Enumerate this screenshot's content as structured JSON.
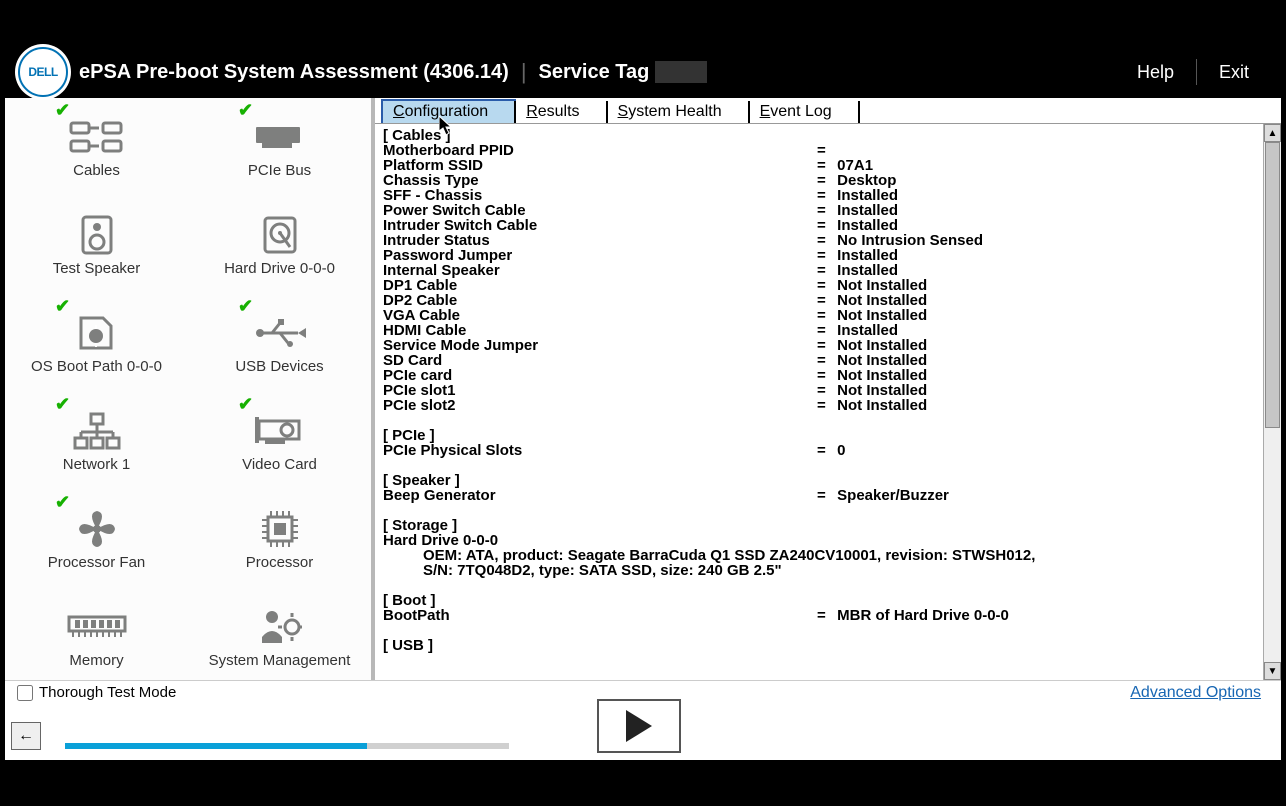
{
  "header": {
    "logo_text": "DELL",
    "title": "ePSA Pre-boot System Assessment (4306.14)",
    "service_tag_label": "Service Tag",
    "help": "Help",
    "exit": "Exit"
  },
  "sidebar": {
    "devices": [
      {
        "label": "Cables",
        "check": true,
        "name": "cables"
      },
      {
        "label": "PCIe Bus",
        "check": true,
        "name": "pcie-bus"
      },
      {
        "label": "Test Speaker",
        "check": false,
        "name": "test-speaker"
      },
      {
        "label": "Hard Drive 0-0-0",
        "check": false,
        "name": "hard-drive"
      },
      {
        "label": "OS Boot Path 0-0-0",
        "check": true,
        "name": "os-boot-path"
      },
      {
        "label": "USB Devices",
        "check": true,
        "name": "usb-devices"
      },
      {
        "label": "Network 1",
        "check": true,
        "name": "network"
      },
      {
        "label": "Video Card",
        "check": true,
        "name": "video-card"
      },
      {
        "label": "Processor Fan",
        "check": true,
        "name": "processor-fan"
      },
      {
        "label": "Processor",
        "check": false,
        "name": "processor"
      },
      {
        "label": "Memory",
        "check": false,
        "name": "memory"
      },
      {
        "label": "System Management",
        "check": false,
        "name": "system-management"
      }
    ]
  },
  "tabs": [
    {
      "label": "Configuration",
      "accel": "C",
      "active": true
    },
    {
      "label": "Results",
      "accel": "R",
      "active": false
    },
    {
      "label": "System Health",
      "accel": "S",
      "active": false
    },
    {
      "label": "Event Log",
      "accel": "E",
      "active": false
    }
  ],
  "config": {
    "sections": [
      {
        "heading": "[ Cables ]",
        "rows": [
          {
            "k": "Motherboard PPID",
            "v": "",
            "redact": true
          },
          {
            "k": "Platform SSID",
            "v": "07A1"
          },
          {
            "k": "Chassis Type",
            "v": "Desktop"
          },
          {
            "k": "SFF - Chassis",
            "v": "Installed"
          },
          {
            "k": "Power Switch Cable",
            "v": "Installed"
          },
          {
            "k": "Intruder Switch Cable",
            "v": "Installed"
          },
          {
            "k": "Intruder Status",
            "v": "No Intrusion Sensed"
          },
          {
            "k": "Password Jumper",
            "v": "Installed"
          },
          {
            "k": "Internal Speaker",
            "v": "Installed"
          },
          {
            "k": "DP1 Cable",
            "v": "Not Installed"
          },
          {
            "k": "DP2 Cable",
            "v": "Not Installed"
          },
          {
            "k": "VGA Cable",
            "v": "Not Installed"
          },
          {
            "k": "HDMI Cable",
            "v": "Installed"
          },
          {
            "k": "Service Mode Jumper",
            "v": "Not Installed"
          },
          {
            "k": "SD Card",
            "v": "Not Installed"
          },
          {
            "k": "PCIe card",
            "v": "Not Installed"
          },
          {
            "k": "PCIe slot1",
            "v": "Not Installed"
          },
          {
            "k": "PCIe slot2",
            "v": "Not Installed"
          }
        ]
      },
      {
        "heading": "[ PCIe ]",
        "gap": true,
        "rows": [
          {
            "k": "PCIe Physical Slots",
            "v": "0"
          }
        ]
      },
      {
        "heading": "[ Speaker ]",
        "gap": true,
        "rows": [
          {
            "k": "Beep Generator",
            "v": "Speaker/Buzzer"
          }
        ]
      },
      {
        "heading": "[ Storage ]",
        "gap": true,
        "rows": [
          {
            "k": "Hard Drive 0-0-0",
            "v": "",
            "noeq": true
          }
        ],
        "extra": [
          "OEM: ATA, product: Seagate BarraCuda Q1 SSD ZA240CV10001, revision: STWSH012,",
          "S/N: 7TQ048D2, type: SATA SSD, size: 240 GB 2.5\""
        ]
      },
      {
        "heading": "[ Boot ]",
        "gap": true,
        "rows": [
          {
            "k": "BootPath",
            "v": "MBR of Hard Drive 0-0-0"
          }
        ]
      },
      {
        "heading": "[ USB ]",
        "gap": true,
        "rows": []
      }
    ]
  },
  "bottom": {
    "thorough_label": "Thorough Test Mode",
    "thorough_checked": false,
    "advanced": "Advanced Options",
    "progress_percent": 68
  }
}
